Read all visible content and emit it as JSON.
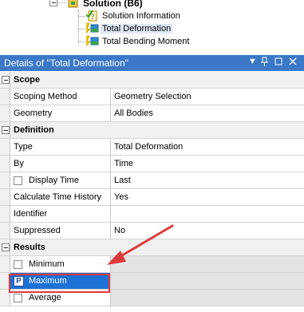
{
  "tree": {
    "solution_label": "Solution (B6)",
    "children": [
      {
        "label": "Solution Information",
        "icon": "solution-information-icon"
      },
      {
        "label": "Total Deformation",
        "icon": "deformation-result-icon",
        "selected": true
      },
      {
        "label": "Total Bending Moment",
        "icon": "bending-moment-result-icon"
      }
    ]
  },
  "details_panel": {
    "title": "Details of \"Total Deformation\"",
    "controls": [
      "▼",
      "ᚹ",
      "□",
      "×"
    ]
  },
  "groups": [
    {
      "title": "Scope",
      "rows": [
        {
          "property": "Scoping Method",
          "value": "Geometry Selection"
        },
        {
          "property": "Geometry",
          "value": "All Bodies"
        }
      ]
    },
    {
      "title": "Definition",
      "rows": [
        {
          "property": "Type",
          "value": "Total Deformation"
        },
        {
          "property": "By",
          "value": "Time"
        },
        {
          "property": "Display Time",
          "value": "Last",
          "checkbox": true
        },
        {
          "property": "Calculate Time History",
          "value": "Yes"
        },
        {
          "property": "Identifier",
          "value": ""
        },
        {
          "property": "Suppressed",
          "value": "No"
        }
      ]
    },
    {
      "title": "Results",
      "rows": [
        {
          "property": "Minimum",
          "value": "",
          "checkbox": true,
          "disabled": true
        },
        {
          "property": "Maximum",
          "value": "",
          "parameter": "P",
          "disabled": true,
          "selected": true
        },
        {
          "property": "Average",
          "value": "",
          "checkbox": true,
          "disabled": true
        }
      ]
    }
  ],
  "colors": {
    "panel_title_bg": "#3b78c7",
    "selection": "#1e72d6",
    "annotation_red": "#e0393b"
  }
}
